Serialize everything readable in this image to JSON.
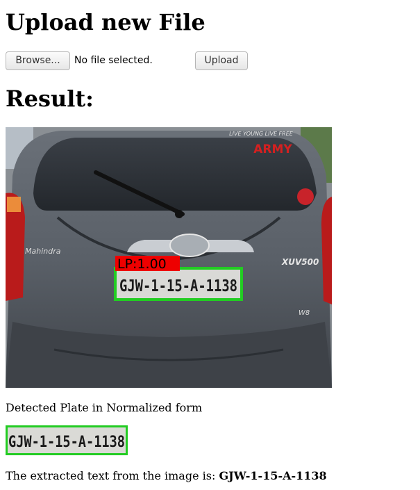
{
  "page": {
    "heading_upload": "Upload new File",
    "heading_result": "Result:",
    "caption": "Detected Plate in Normalized form",
    "extract_prefix": "The extracted text from the image is: ",
    "extract_value": "GJW-1-15-A-1138"
  },
  "form": {
    "browse_label": "Browse...",
    "file_status": "No file selected.",
    "upload_label": "Upload"
  },
  "result_image": {
    "rear_text_1": "LIVE YOUNG LIVE FREE",
    "rear_text_2": "ARMY",
    "brand_text": "Mahindra",
    "model_text": "XUV500",
    "badge_text": "W8",
    "detection_label": "LP:1.00",
    "plate_text": "GJW-1-15-A-1138",
    "box_color": "#22cc22",
    "label_bg_color": "#ee0000"
  },
  "plate_crop": {
    "plate_text": "GJW-1-15-A-1138",
    "box_color": "#22cc22"
  }
}
